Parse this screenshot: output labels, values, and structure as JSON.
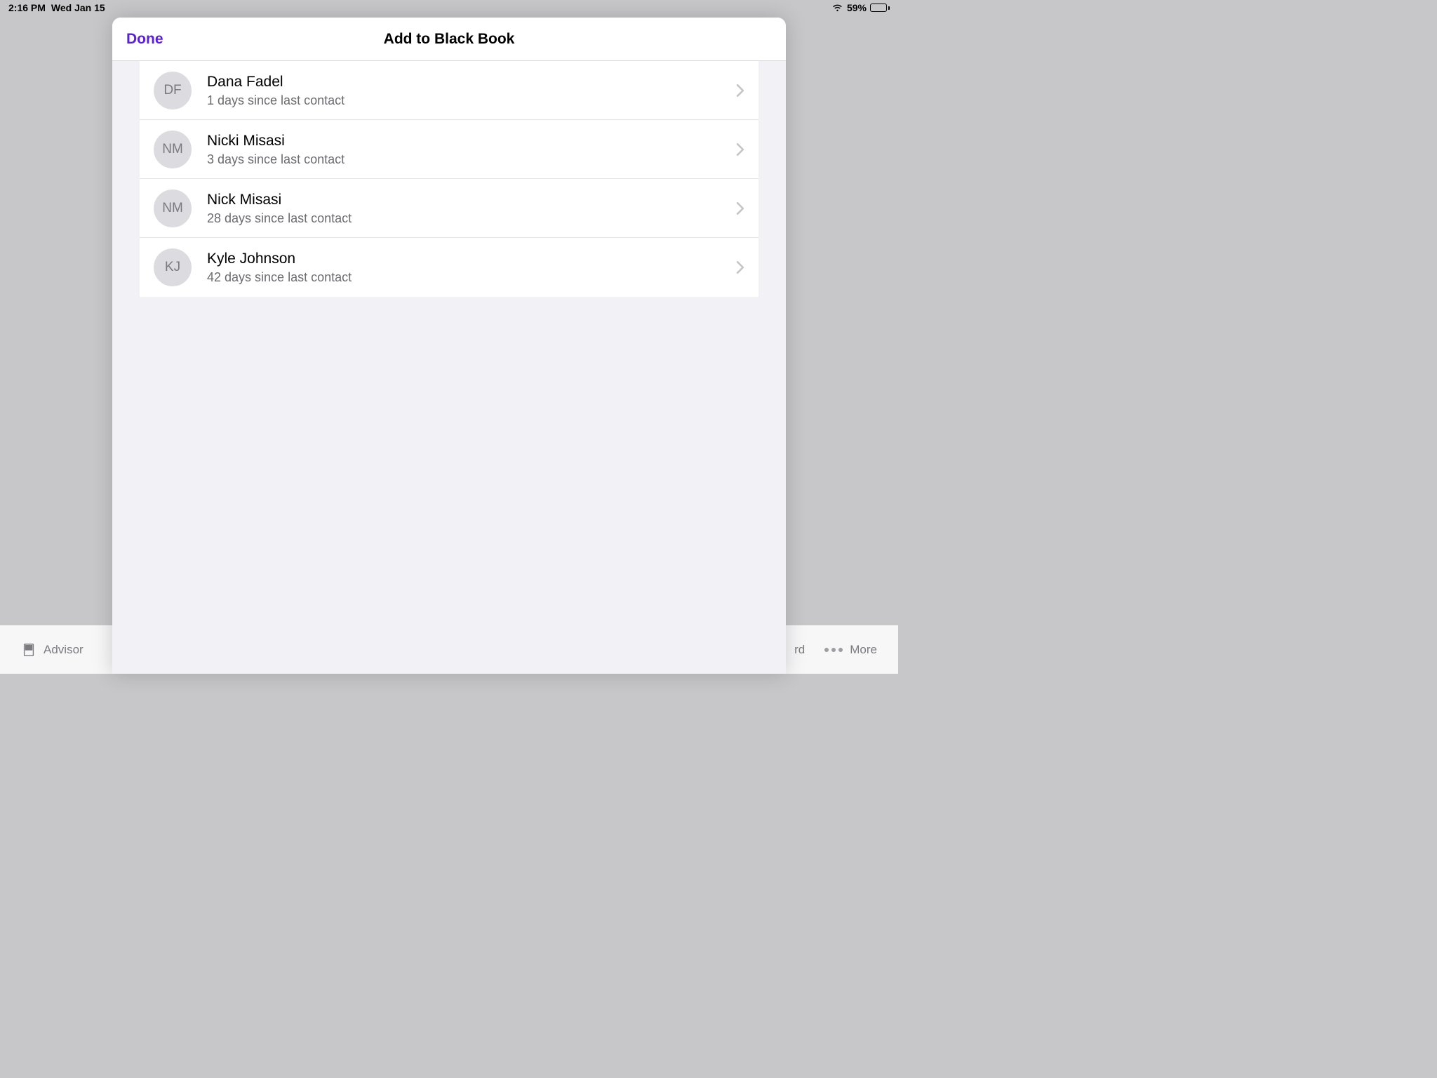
{
  "status_bar": {
    "time": "2:16 PM",
    "date": "Wed Jan 15",
    "battery_percent": "59%"
  },
  "modal": {
    "done_label": "Done",
    "title": "Add to Black Book"
  },
  "contacts": [
    {
      "initials": "DF",
      "name": "Dana Fadel",
      "subtitle": "1 days since last contact"
    },
    {
      "initials": "NM",
      "name": "Nicki Misasi",
      "subtitle": "3 days since last contact"
    },
    {
      "initials": "NM",
      "name": "Nick Misasi",
      "subtitle": "28 days since last contact"
    },
    {
      "initials": "KJ",
      "name": "Kyle Johnson",
      "subtitle": "42 days since last contact"
    }
  ],
  "tab_bar": {
    "left_label": "Advisor",
    "partial_label": "rd",
    "more_label": "More"
  }
}
